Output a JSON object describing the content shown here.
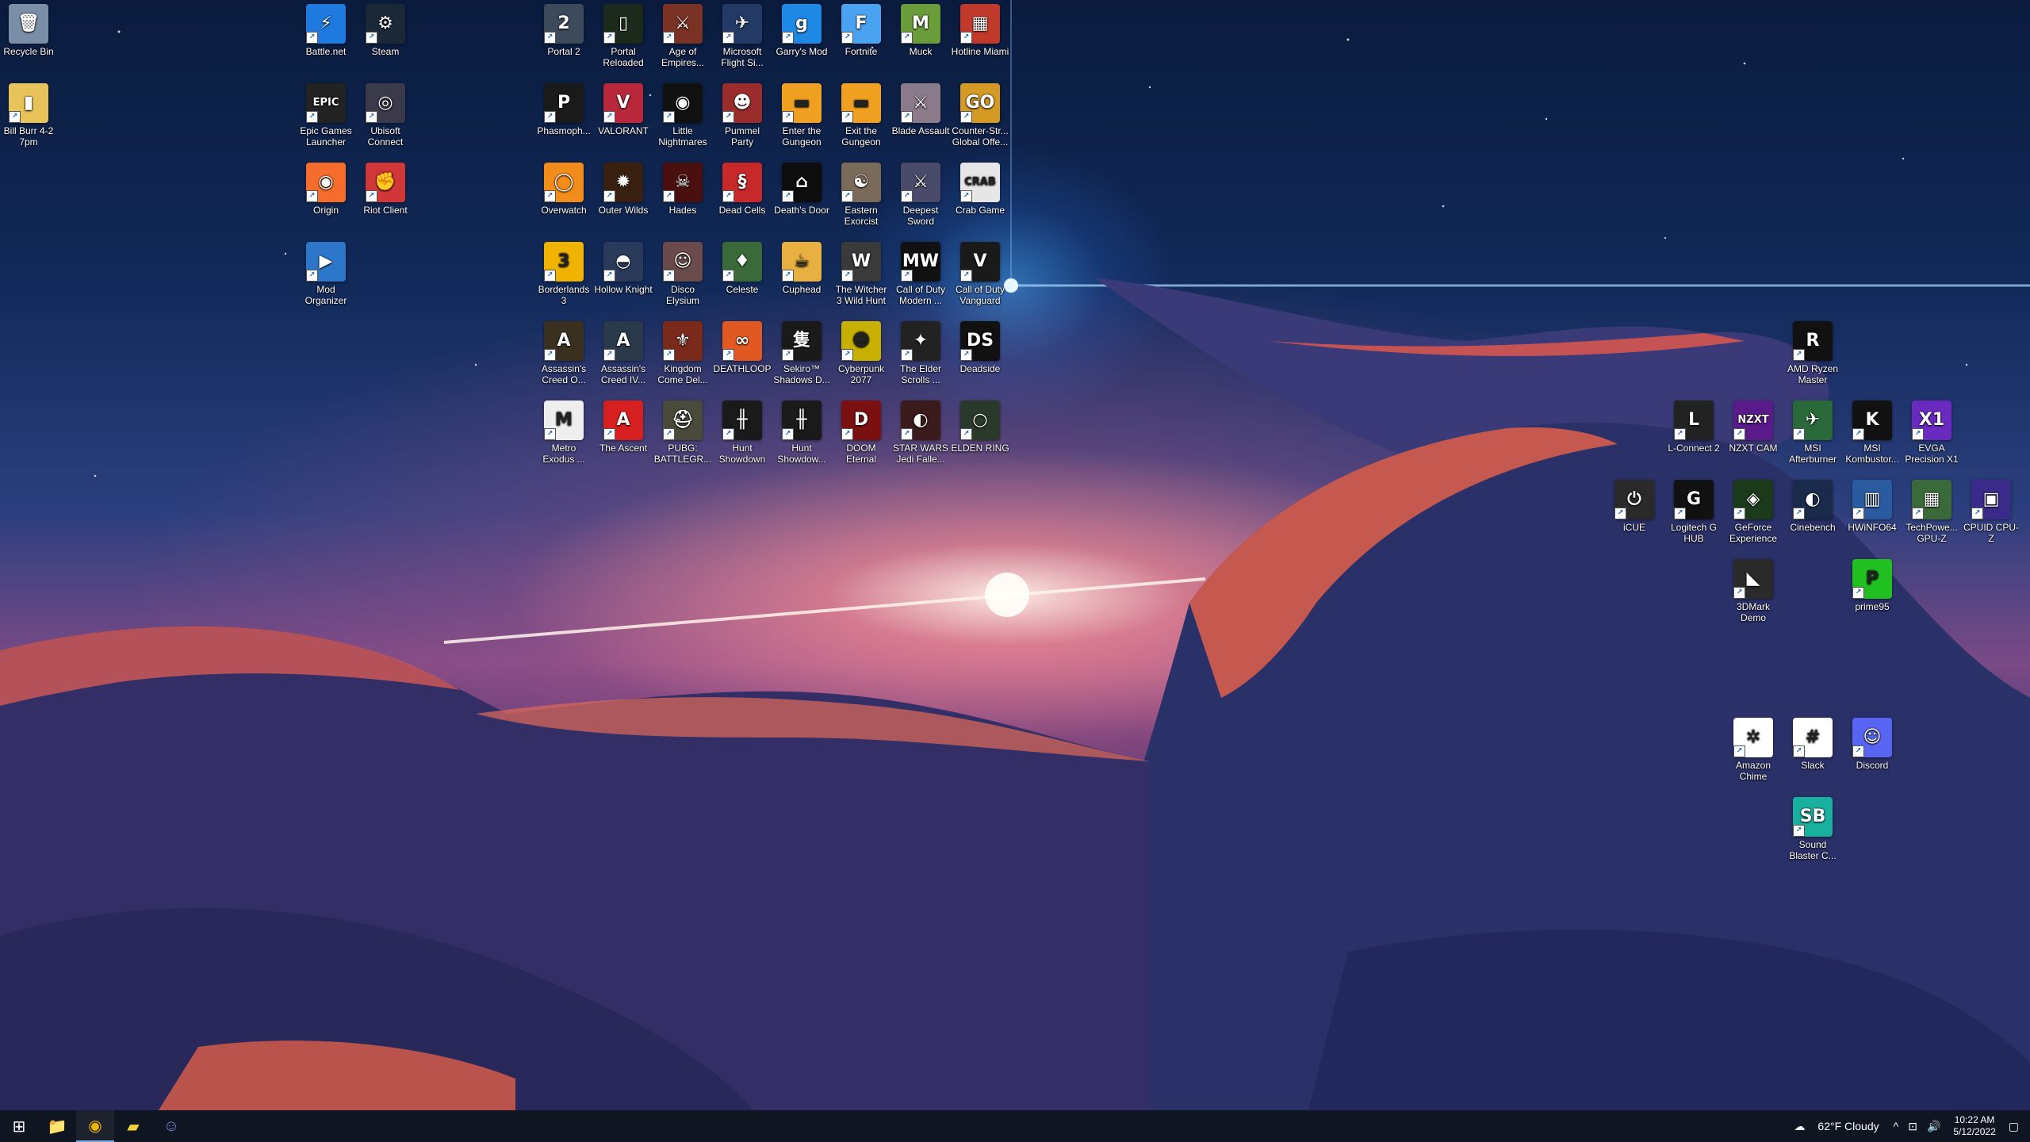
{
  "desktop_icons": [
    {
      "label": "Recycle Bin",
      "glyph": "🗑",
      "color": "#7b8ea8"
    },
    {
      "label": "Bill Burr 4-2 7pm",
      "glyph": "▮",
      "color": "#e8c35a"
    },
    {
      "label": "Battle.net",
      "glyph": "⚡",
      "color": "#1f7ae0"
    },
    {
      "label": "Steam",
      "glyph": "⚙",
      "color": "#1b2838"
    },
    {
      "label": "Epic Games Launcher",
      "glyph": "EPIC",
      "color": "#222222"
    },
    {
      "label": "Ubisoft Connect",
      "glyph": "◎",
      "color": "#3a3a4a"
    },
    {
      "label": "Origin",
      "glyph": "◉",
      "color": "#f56c2d"
    },
    {
      "label": "Riot Client",
      "glyph": "✊",
      "color": "#d13639"
    },
    {
      "label": "Mod Organizer",
      "glyph": "▶",
      "color": "#2c77c9"
    },
    {
      "label": "Portal 2",
      "glyph": "2",
      "color": "#3d4a5c"
    },
    {
      "label": "Portal Reloaded",
      "glyph": "▯",
      "color": "#1c2a1c"
    },
    {
      "label": "Age of Empires...",
      "glyph": "⚔",
      "color": "#7a3224"
    },
    {
      "label": "Microsoft Flight Si...",
      "glyph": "✈",
      "color": "#233a66"
    },
    {
      "label": "Garry's Mod",
      "glyph": "g",
      "color": "#1e88e5"
    },
    {
      "label": "Fortnite",
      "glyph": "F",
      "color": "#4aa3f0"
    },
    {
      "label": "Muck",
      "glyph": "M",
      "color": "#6b9c3a"
    },
    {
      "label": "Hotline Miami",
      "glyph": "▦",
      "color": "#c0392b"
    },
    {
      "label": "Phasmoph...",
      "glyph": "P",
      "color": "#1a1a1a"
    },
    {
      "label": "VALORANT",
      "glyph": "V",
      "color": "#b8283a"
    },
    {
      "label": "Little Nightmares",
      "glyph": "◉",
      "color": "#111111"
    },
    {
      "label": "Pummel Party",
      "glyph": "☻",
      "color": "#9b2c2c"
    },
    {
      "label": "Enter the Gungeon",
      "glyph": "▬",
      "color": "#f0a020"
    },
    {
      "label": "Exit the Gungeon",
      "glyph": "▬",
      "color": "#f0a020"
    },
    {
      "label": "Blade Assault",
      "glyph": "⚔",
      "color": "#8a7a8a"
    },
    {
      "label": "Counter-Str... Global Offe...",
      "glyph": "GO",
      "color": "#d49a24"
    },
    {
      "label": "Overwatch",
      "glyph": "◯",
      "color": "#f28c1a"
    },
    {
      "label": "Outer Wilds",
      "glyph": "✹",
      "color": "#3a2010"
    },
    {
      "label": "Hades",
      "glyph": "☠",
      "color": "#4a1010"
    },
    {
      "label": "Dead Cells",
      "glyph": "§",
      "color": "#c7282a"
    },
    {
      "label": "Death's Door",
      "glyph": "⌂",
      "color": "#0d0d0d"
    },
    {
      "label": "Eastern Exorcist",
      "glyph": "☯",
      "color": "#7a6a5a"
    },
    {
      "label": "Deepest Sword",
      "glyph": "⚔",
      "color": "#4a4a6a"
    },
    {
      "label": "Crab Game",
      "glyph": "CRAB",
      "color": "#e6e6e6"
    },
    {
      "label": "Borderlands 3",
      "glyph": "3",
      "color": "#f0b400"
    },
    {
      "label": "Hollow Knight",
      "glyph": "◓",
      "color": "#2a3a5a"
    },
    {
      "label": "Disco Elysium",
      "glyph": "☺",
      "color": "#6a4a4a"
    },
    {
      "label": "Celeste",
      "glyph": "♦",
      "color": "#3a6a3a"
    },
    {
      "label": "Cuphead",
      "glyph": "☕",
      "color": "#e8b040"
    },
    {
      "label": "The Witcher 3 Wild Hunt",
      "glyph": "W",
      "color": "#3a3a3a"
    },
    {
      "label": "Call of Duty Modern ...",
      "glyph": "MW",
      "color": "#111111"
    },
    {
      "label": "Call of Duty Vanguard",
      "glyph": "V",
      "color": "#1a1a1a"
    },
    {
      "label": "Assassin's Creed O...",
      "glyph": "A",
      "color": "#3a3020"
    },
    {
      "label": "Assassin's Creed IV...",
      "glyph": "A",
      "color": "#2a3a4a"
    },
    {
      "label": "Kingdom Come Del...",
      "glyph": "⚜",
      "color": "#7a2a1a"
    },
    {
      "label": "DEATHLOOP",
      "glyph": "∞",
      "color": "#e25822"
    },
    {
      "label": "Sekiro™ Shadows D...",
      "glyph": "隻",
      "color": "#1a1a1a"
    },
    {
      "label": "Cyberpunk 2077",
      "glyph": "☻",
      "color": "#c8b000"
    },
    {
      "label": "The Elder Scrolls ...",
      "glyph": "✦",
      "color": "#222222"
    },
    {
      "label": "Deadside",
      "glyph": "DS",
      "color": "#111111"
    },
    {
      "label": "Metro Exodus ...",
      "glyph": "M",
      "color": "#eeeeee"
    },
    {
      "label": "The Ascent",
      "glyph": "A",
      "color": "#d62020"
    },
    {
      "label": "PUBG: BATTLEGR...",
      "glyph": "⛑",
      "color": "#4a4a3a"
    },
    {
      "label": "Hunt Showdown",
      "glyph": "╫",
      "color": "#1a1a1a"
    },
    {
      "label": "Hunt Showdow...",
      "glyph": "╫",
      "color": "#1a1a1a"
    },
    {
      "label": "DOOM Eternal",
      "glyph": "D",
      "color": "#7a1010"
    },
    {
      "label": "STAR WARS Jedi Falle...",
      "glyph": "◐",
      "color": "#3a1a1a"
    },
    {
      "label": "ELDEN RING",
      "glyph": "○",
      "color": "#2a3a2a"
    },
    {
      "label": "AMD Ryzen Master",
      "glyph": "R",
      "color": "#111111"
    },
    {
      "label": "L-Connect 2",
      "glyph": "L",
      "color": "#222222"
    },
    {
      "label": "NZXT CAM",
      "glyph": "NZXT",
      "color": "#5a1a8a"
    },
    {
      "label": "MSI Afterburner",
      "glyph": "✈",
      "color": "#2a6a3a"
    },
    {
      "label": "MSI Kombustor...",
      "glyph": "K",
      "color": "#111111"
    },
    {
      "label": "EVGA Precision X1",
      "glyph": "X1",
      "color": "#6a2ac0"
    },
    {
      "label": "iCUE",
      "glyph": "⏻",
      "color": "#2a2a2a"
    },
    {
      "label": "Logitech G HUB",
      "glyph": "G",
      "color": "#111111"
    },
    {
      "label": "GeForce Experience",
      "glyph": "◈",
      "color": "#1a3a1a"
    },
    {
      "label": "Cinebench",
      "glyph": "◐",
      "color": "#1a2a4a"
    },
    {
      "label": "HWiNFO64",
      "glyph": "▥",
      "color": "#2a5aa0"
    },
    {
      "label": "TechPowe... GPU-Z",
      "glyph": "▦",
      "color": "#3a6a3a"
    },
    {
      "label": "CPUID CPU-Z",
      "glyph": "▣",
      "color": "#3a2a8a"
    },
    {
      "label": "3DMark Demo",
      "glyph": "◣",
      "color": "#2a2a2a"
    },
    {
      "label": "prime95",
      "glyph": "P",
      "color": "#20c020"
    },
    {
      "label": "Amazon Chime",
      "glyph": "✲",
      "color": "#ffffff"
    },
    {
      "label": "Slack",
      "glyph": "#",
      "color": "#ffffff"
    },
    {
      "label": "Discord",
      "glyph": "☺",
      "color": "#5865f2"
    },
    {
      "label": "Sound Blaster C...",
      "glyph": "SB",
      "color": "#1ab0a0"
    }
  ],
  "taskbar": {
    "apps": [
      {
        "name": "start",
        "glyph": "⊞"
      },
      {
        "name": "file-explorer",
        "glyph": "📁"
      },
      {
        "name": "chrome",
        "glyph": "◉"
      },
      {
        "name": "sticky-notes",
        "glyph": "▰"
      },
      {
        "name": "discord",
        "glyph": "☺"
      }
    ],
    "weather": "62°F  Cloudy",
    "time": "10:22 AM",
    "date": "5/12/2022"
  }
}
